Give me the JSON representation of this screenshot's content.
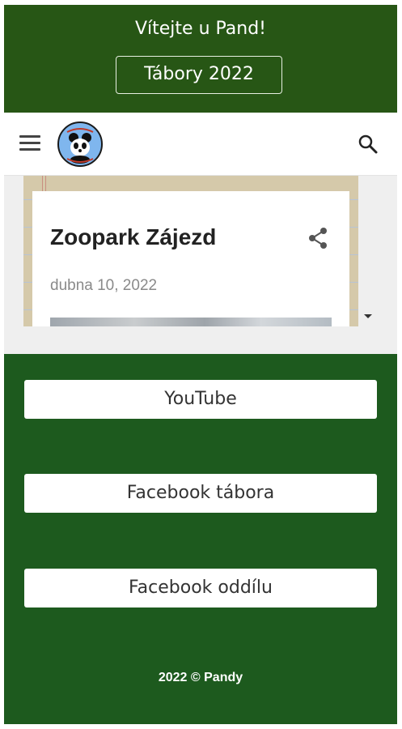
{
  "header": {
    "welcome": "Vítejte u Pand!",
    "camps_button": "Tábory 2022"
  },
  "navbar": {
    "menu_icon": "hamburger-menu-icon",
    "logo": "panda-logo",
    "search_icon": "search-icon"
  },
  "post": {
    "title": "Zoopark Zájezd",
    "date": "dubna 10, 2022",
    "share_icon": "share-icon"
  },
  "links": [
    {
      "label": "YouTube"
    },
    {
      "label": "Facebook tábora"
    },
    {
      "label": "Facebook oddílu"
    }
  ],
  "footer": {
    "text": "2022 © Pandy"
  },
  "colors": {
    "header_green": "#275615",
    "page_green": "#1d5a1e",
    "white": "#ffffff"
  }
}
